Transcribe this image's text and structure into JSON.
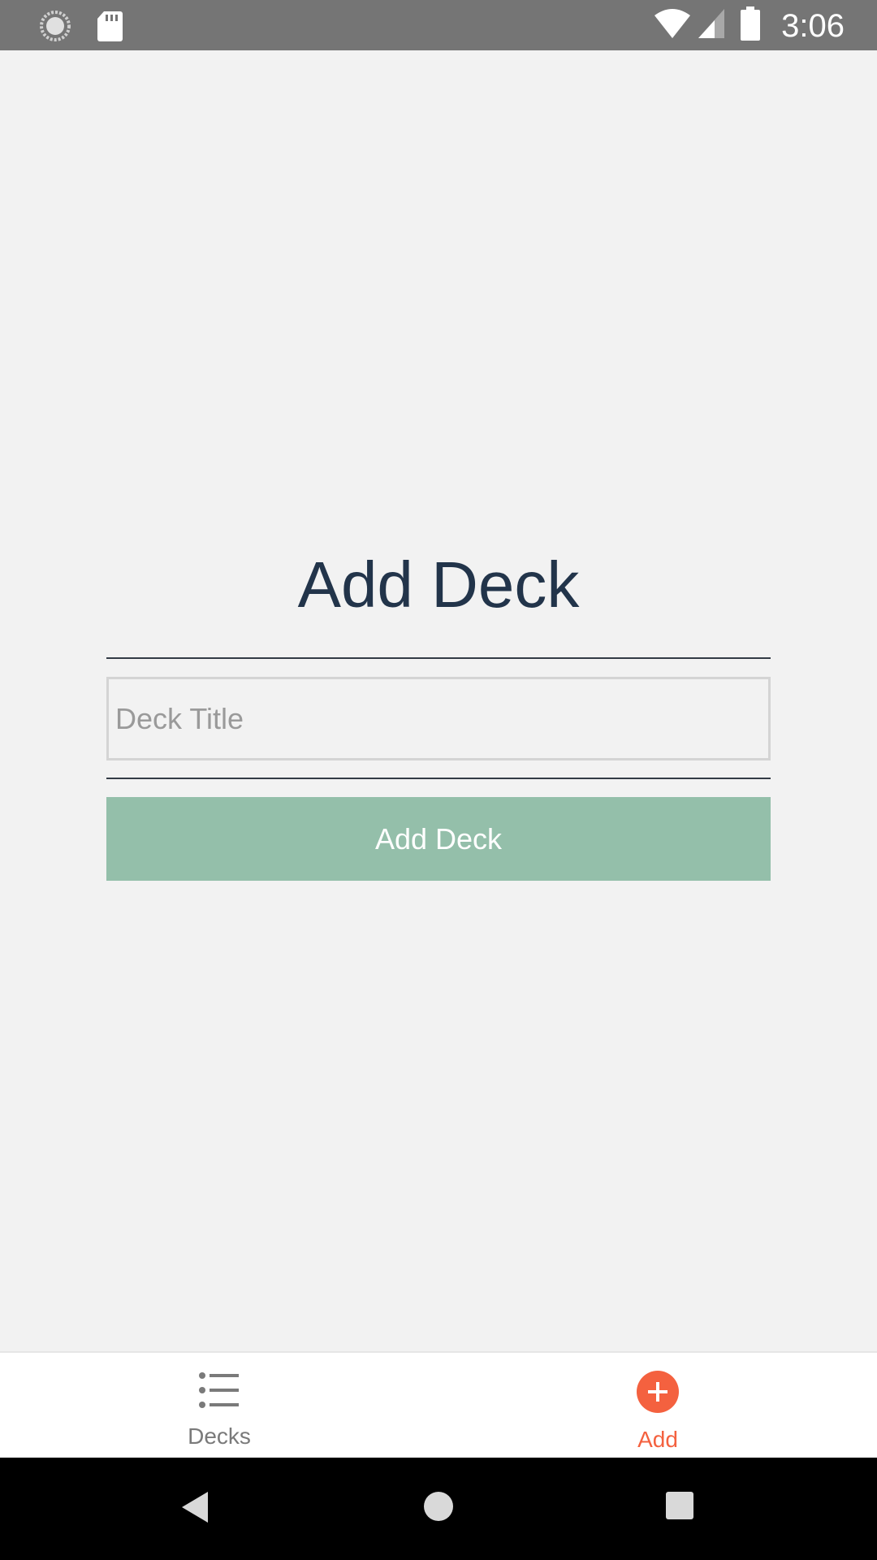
{
  "status_bar": {
    "time": "3:06",
    "icons": [
      "sync-icon",
      "sd-card-icon",
      "wifi-icon",
      "signal-icon",
      "battery-icon"
    ]
  },
  "main": {
    "title": "Add Deck",
    "deck_title_input": {
      "value": "",
      "placeholder": "Deck Title"
    },
    "submit_label": "Add Deck"
  },
  "tabs": [
    {
      "label": "Decks",
      "icon": "list-icon",
      "active": false
    },
    {
      "label": "Add",
      "icon": "add-circle-icon",
      "active": true
    }
  ],
  "nav": {
    "icons": [
      "back-icon",
      "home-icon",
      "recents-icon"
    ]
  },
  "colors": {
    "accent": "#f4613f",
    "button": "#94bfaa",
    "title": "#22344a",
    "status_bar": "#757575"
  }
}
